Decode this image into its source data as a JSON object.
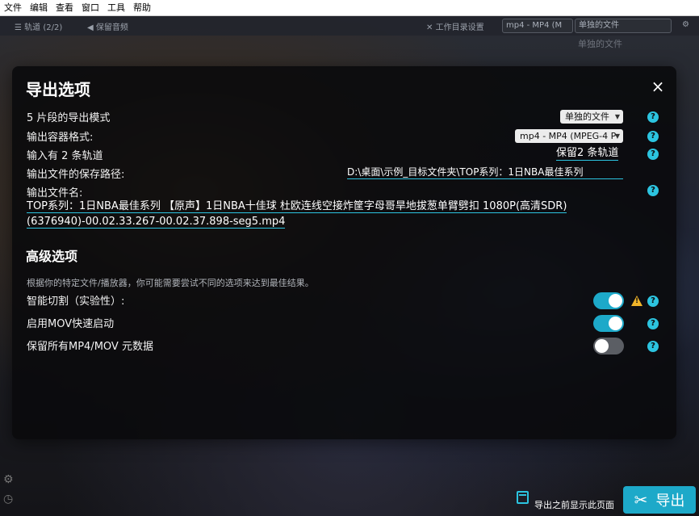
{
  "menubar": {
    "items": [
      "文件",
      "编辑",
      "查看",
      "窗口",
      "工具",
      "帮助"
    ]
  },
  "toolbar": {
    "tracks_label": "轨道 (2/2)",
    "keep_audio_label": "保留音频",
    "workdir_label": "工作目录设置",
    "format_select": "mp4 - MP4 (M",
    "mode_select": "单独的文件"
  },
  "background": {
    "faded_text": "单独的文件"
  },
  "modal": {
    "title": "导出选项",
    "close_icon": "×",
    "rows": {
      "export_mode_label": "5 片段的导出模式",
      "export_mode_value": "单独的文件",
      "container_label": "输出容器格式:",
      "container_value": "mp4 - MP4 (MPEG-4 P",
      "tracks_label": "输入有 2 条轨道",
      "tracks_value": "保留2 条轨道",
      "save_path_label": "输出文件的保存路径:",
      "save_path_value": "D:\\桌面\\示例_目标文件夹\\TOP系列：1日NBA最佳系列",
      "filename_label": "输出文件名:",
      "filename_value": "TOP系列：1日NBA最佳系列 【原声】1日NBA十佳球 杜欧连线空接炸筐字母哥旱地拔葱单臂劈扣 1080P(高清SDR)(6376940)-00.02.33.267-00.02.37.898-seg5.mp4"
    },
    "advanced": {
      "title": "高级选项",
      "hint": "根据你的特定文件/播放器，你可能需要尝试不同的选项来达到最佳结果。",
      "smart_cut_label": "智能切割（实验性）:",
      "smart_cut_on": true,
      "mov_faststart_label": "启用MOV快速启动",
      "mov_faststart_on": true,
      "keep_metadata_label": "保留所有MP4/MOV 元数据",
      "keep_metadata_on": false
    },
    "help_glyph": "?",
    "warn_glyph": "!"
  },
  "bottom": {
    "show_before_export_label": "导出之前显示此页面",
    "export_button_label": "导出"
  },
  "colors": {
    "accent": "#1da9c9",
    "help": "#2cc4e0",
    "warning": "#f0b429"
  }
}
